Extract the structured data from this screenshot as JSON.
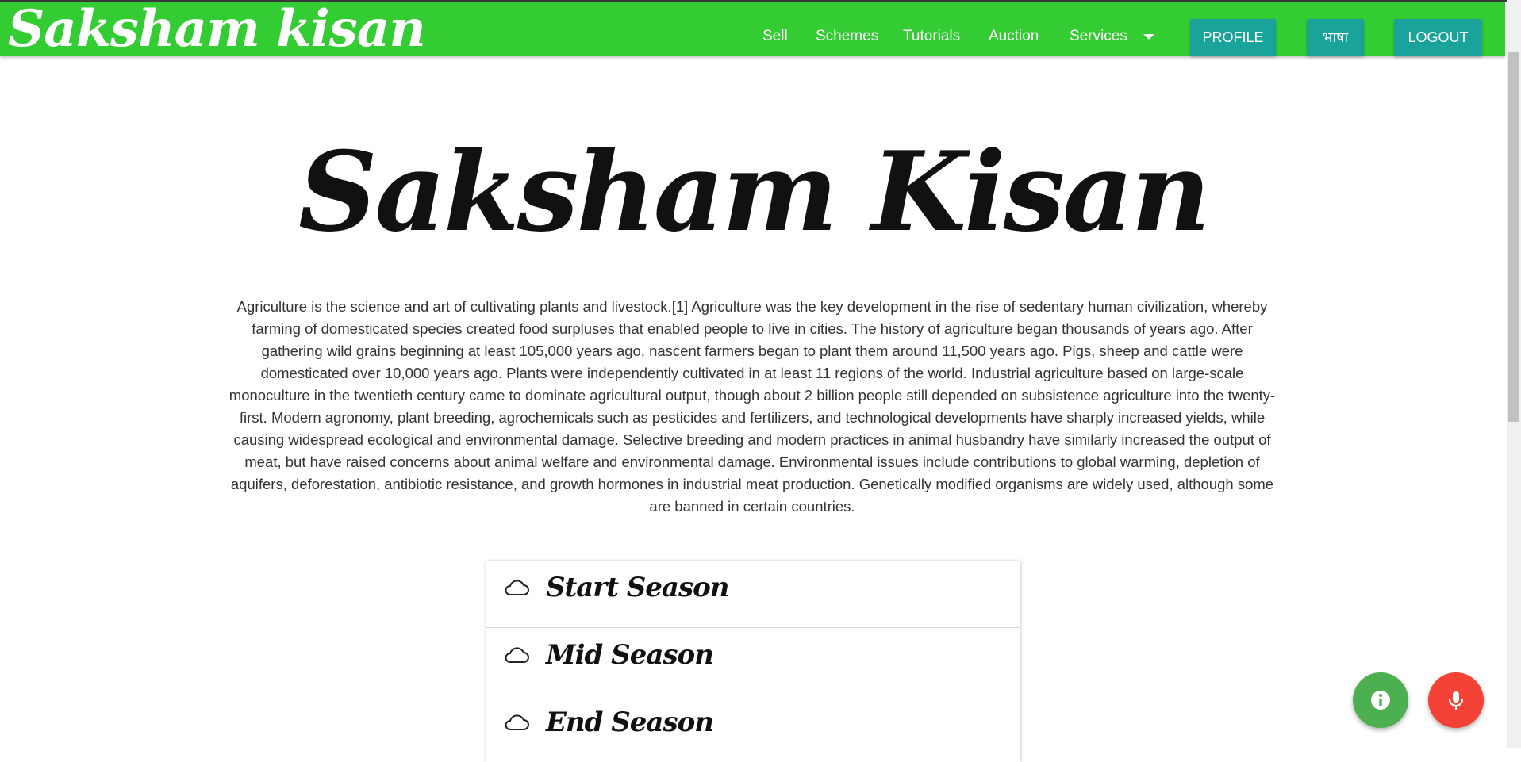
{
  "header": {
    "brand": "Saksham kisan",
    "nav": [
      "Sell",
      "Schemes",
      "Tutorials",
      "Auction",
      "Services"
    ],
    "buttons": {
      "profile": "PROFILE",
      "language": "भाषा",
      "logout": "LOGOUT"
    }
  },
  "main": {
    "title": "Saksham Kisan",
    "intro": "Agriculture is the science and art of cultivating plants and livestock.[1] Agriculture was the key development in the rise of sedentary human civilization, whereby farming of domesticated species created food surpluses that enabled people to live in cities. The history of agriculture began thousands of years ago. After gathering wild grains beginning at least 105,000 years ago, nascent farmers began to plant them around 11,500 years ago. Pigs, sheep and cattle were domesticated over 10,000 years ago. Plants were independently cultivated in at least 11 regions of the world. Industrial agriculture based on large-scale monoculture in the twentieth century came to dominate agricultural output, though about 2 billion people still depended on subsistence agriculture into the twenty-first. Modern agronomy, plant breeding, agrochemicals such as pesticides and fertilizers, and technological developments have sharply increased yields, while causing widespread ecological and environmental damage. Selective breeding and modern practices in animal husbandry have similarly increased the output of meat, but have raised concerns about animal welfare and environmental damage. Environmental issues include contributions to global warming, depletion of aquifers, deforestation, antibiotic resistance, and growth hormones in industrial meat production. Genetically modified organisms are widely used, although some are banned in certain countries.",
    "seasons": [
      "Start Season",
      "Mid Season",
      "End Season"
    ]
  },
  "colors": {
    "navbar": "#33cc33",
    "button": "#1aa39a",
    "info_fab": "#4caf50",
    "mic_fab": "#f44336"
  },
  "icons": {
    "season": "cloud-icon",
    "info_fab": "info-icon",
    "mic_fab": "microphone-icon",
    "services_caret": "caret-down-icon"
  }
}
